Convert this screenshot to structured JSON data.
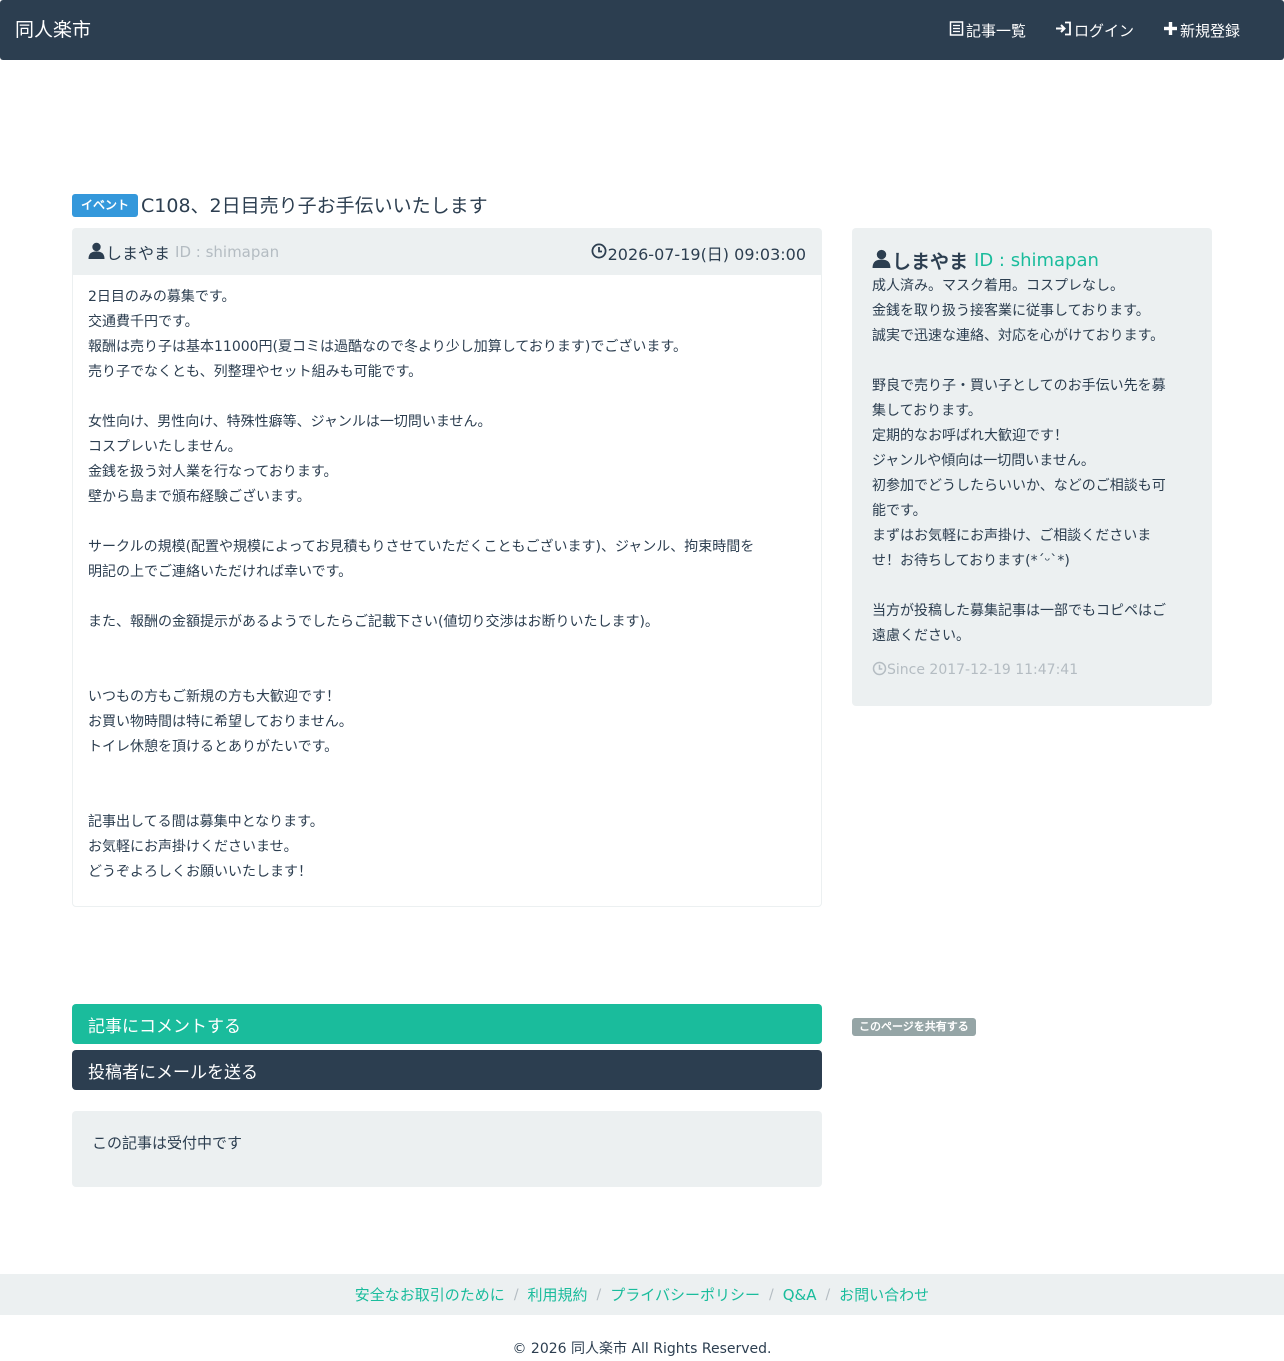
{
  "navbar": {
    "brand": "同人楽市",
    "links": [
      {
        "label": "記事一覧",
        "icon": "list-icon"
      },
      {
        "label": "ログイン",
        "icon": "login-icon"
      },
      {
        "label": "新規登録",
        "icon": "plus-icon"
      }
    ]
  },
  "post": {
    "category": "イベント",
    "title": "C108、2日目売り子お手伝いいたします",
    "author": "しまやま",
    "author_id": "ID : shimapan",
    "date": "2026-07-19(日) 09:03:00",
    "body": [
      "2日目のみの募集です。",
      "交通費千円です。",
      "報酬は売り子は基本11000円(夏コミは過酷なので冬より少し加算しております)でございます。",
      "売り子でなくとも、列整理やセット組みも可能です。",
      "",
      "女性向け、男性向け、特殊性癖等、ジャンルは一切問いません。",
      "コスプレいたしません。",
      "金銭を扱う対人業を行なっております。",
      "壁から島まで頒布経験ございます。",
      "",
      "サークルの規模(配置や規模によってお見積もりさせていただくこともございます)、ジャンル、拘束時間を",
      "明記の上でご連絡いただければ幸いです。",
      "",
      "また、報酬の金額提示があるようでしたらご記載下さい(値切り交渉はお断りいたします)。",
      "",
      "",
      "いつもの方もご新規の方も大歓迎です！",
      "お買い物時間は特に希望しておりません。",
      "トイレ休憩を頂けるとありがたいです。",
      "",
      "",
      "記事出してる間は募集中となります。",
      "お気軽にお声掛けくださいませ。",
      "どうぞよろしくお願いいたします！"
    ]
  },
  "profile": {
    "name": "しまやま",
    "id": "ID : shimapan",
    "bio": [
      "成人済み。マスク着用。コスプレなし。",
      "金銭を取り扱う接客業に従事しております。",
      "誠実で迅速な連絡、対応を心がけております。",
      "",
      "野良で売り子・買い子としてのお手伝い先を募",
      "集しております。",
      "定期的なお呼ばれ大歓迎です！",
      "ジャンルや傾向は一切問いません。",
      "初参加でどうしたらいいか、などのご相談も可",
      "能です。",
      "まずはお気軽にお声掛け、ご相談くださいま",
      "せ！お待ちしております(*ˊᵕˋ*)",
      "",
      "当方が投稿した募集記事は一部でもコピペはご",
      "遠慮ください。"
    ],
    "since": "Since 2017-12-19 11:47:41"
  },
  "actions": {
    "comment": "記事にコメントする",
    "mail": "投稿者にメールを送る",
    "share": "このページを共有する",
    "status": "この記事は受付中です"
  },
  "footer": {
    "links": [
      "安全なお取引のために",
      "利用規約",
      "プライバシーポリシー",
      "Q&A",
      "お問い合わせ"
    ],
    "copyright": "© 2026 同人楽市 All Rights Reserved."
  },
  "colors": {
    "navbar": "#2c3e50",
    "accent": "#1abc9c",
    "event_label": "#3498db",
    "panel_bg": "#ecf0f1",
    "muted": "#b4bcc2",
    "share_badge": "#95a5a6"
  }
}
